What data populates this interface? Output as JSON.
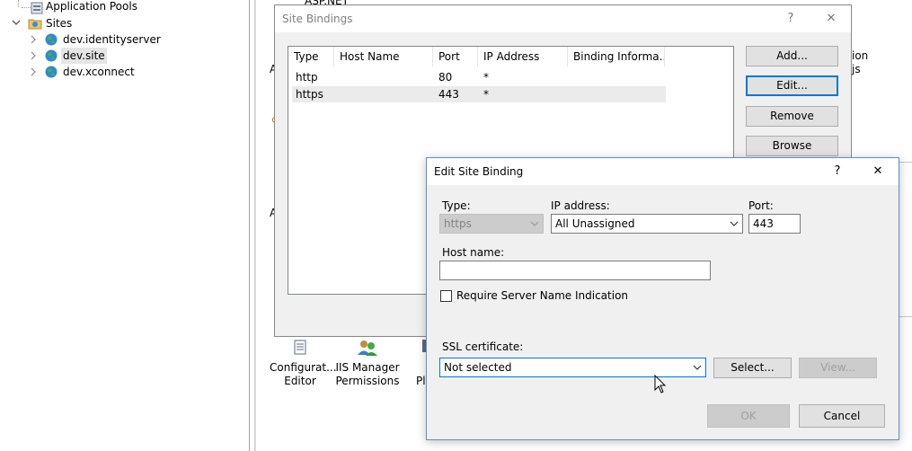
{
  "tree": {
    "items": [
      {
        "label": "Application Pools",
        "icon": "app-pool-icon"
      },
      {
        "label": "Sites",
        "icon": "folder-icon"
      },
      {
        "label": "dev.identityserver",
        "icon": "globe-icon"
      },
      {
        "label": "dev.site",
        "icon": "globe-icon"
      },
      {
        "label": "dev.xconnect",
        "icon": "globe-icon"
      }
    ]
  },
  "features": {
    "items": [
      {
        "line1": "Configurat...",
        "line2": "Editor"
      },
      {
        "line1": "IIS Manager",
        "line2": "Permissions"
      },
      {
        "line1": "Pl",
        "line2": ""
      }
    ],
    "fragments": {
      "top": "ASP.NET",
      "right1": "ion",
      "right2": "js",
      "left_a": "A",
      "left_b": "A"
    }
  },
  "site_bindings": {
    "title": "Site Bindings",
    "help": "?",
    "close": "✕",
    "columns": [
      "Type",
      "Host Name",
      "Port",
      "IP Address",
      "Binding Informa..."
    ],
    "rows": [
      {
        "type": "http",
        "host": "",
        "port": "80",
        "ip": "*",
        "info": ""
      },
      {
        "type": "https",
        "host": "",
        "port": "443",
        "ip": "*",
        "info": ""
      }
    ],
    "buttons": {
      "add": "Add...",
      "edit": "Edit...",
      "remove": "Remove",
      "browse": "Browse"
    }
  },
  "edit_binding": {
    "title": "Edit Site Binding",
    "help": "?",
    "close": "✕",
    "type_label": "Type:",
    "type_value": "https",
    "ip_label": "IP address:",
    "ip_value": "All Unassigned",
    "port_label": "Port:",
    "port_value": "443",
    "host_label": "Host name:",
    "host_value": "",
    "sni_label": "Require Server Name Indication",
    "ssl_label": "SSL certificate:",
    "ssl_value": "Not selected",
    "buttons": {
      "select": "Select...",
      "view": "View...",
      "ok": "OK",
      "cancel": "Cancel"
    }
  }
}
